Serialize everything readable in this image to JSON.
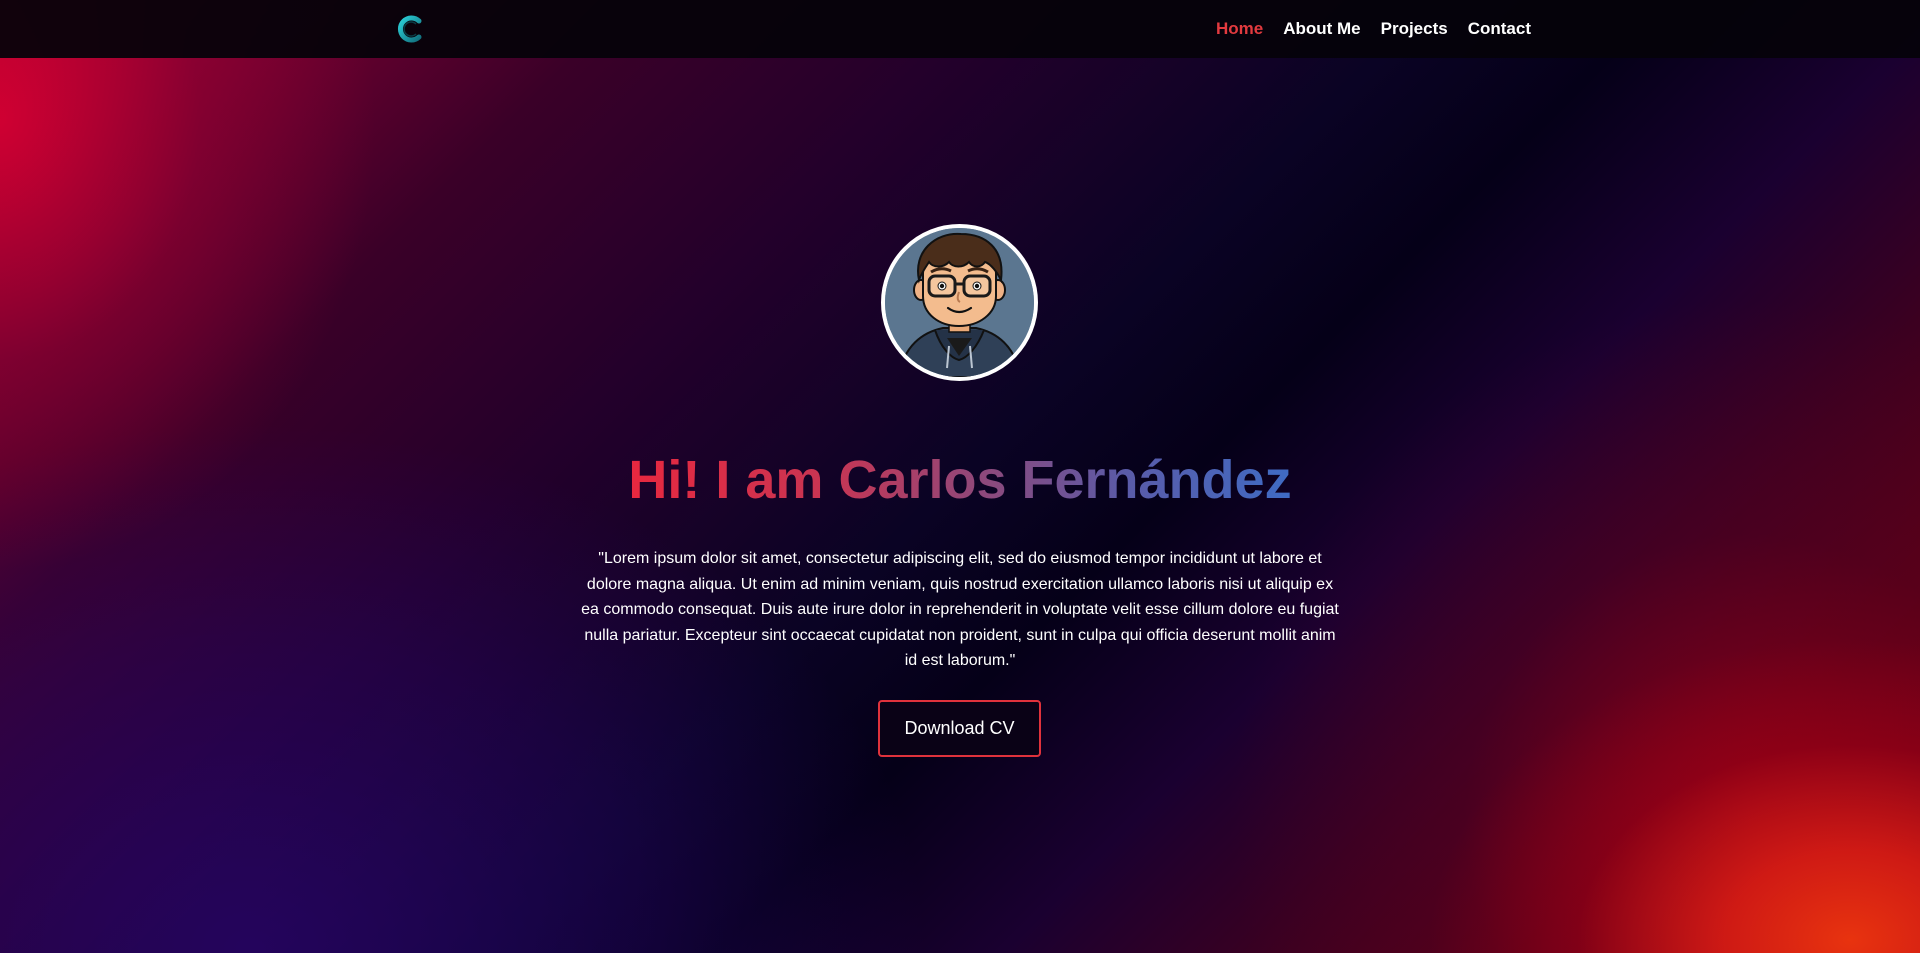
{
  "colors": {
    "nav_active": "#e23a3f",
    "nav_text": "#ffffff",
    "title_gradient_start": "#e8283f",
    "title_gradient_end": "#3f6bc4",
    "button_border": "#e0323c",
    "logo": "#1fa8b4"
  },
  "header": {
    "logo_icon": "c-logo-icon",
    "nav": [
      {
        "label": "Home",
        "active": true
      },
      {
        "label": "About Me",
        "active": false
      },
      {
        "label": "Projects",
        "active": false
      },
      {
        "label": "Contact",
        "active": false
      }
    ]
  },
  "hero": {
    "avatar_icon": "cartoon-avatar",
    "title": "Hi! I am Carlos Fernández",
    "description": "\"Lorem ipsum dolor sit amet, consectetur adipiscing elit, sed do eiusmod tempor incididunt ut labore et dolore magna aliqua. Ut enim ad minim veniam, quis nostrud exercitation ullamco laboris nisi ut aliquip ex ea commodo consequat. Duis aute irure dolor in reprehenderit in voluptate velit esse cillum dolore eu fugiat nulla pariatur. Excepteur sint occaecat cupidatat non proident, sunt in culpa qui officia deserunt mollit anim id est laborum.\"",
    "cta_label": "Download CV"
  }
}
